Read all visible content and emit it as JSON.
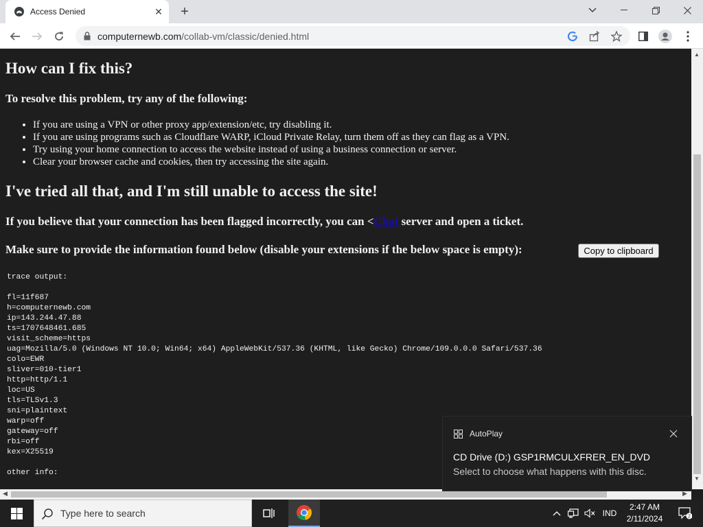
{
  "browser": {
    "tab_title": "Access Denied",
    "url_host": "computernewb.com",
    "url_path": "/collab-vm/classic/denied.html"
  },
  "page": {
    "heading_fix": "How can I fix this?",
    "subheading_resolve": "To resolve this problem, try any of the following:",
    "fix_items": [
      "If you are using a VPN or other proxy app/extension/etc, try disabling it.",
      "If you are using programs such as Cloudflare WARP, iCloud Private Relay, turn them off as they can flag as a VPN.",
      "Try using your home connection to access the website instead of using a business connection or server.",
      "Clear your browser cache and cookies, then try accessing the site again."
    ],
    "heading_tried": "I've tried all that, and I'm still unable to access the site!",
    "flagged_prefix": "If you believe that your connection has been flagged incorrectly, you can <",
    "flagged_link": "Chat",
    "flagged_suffix": " server and open a ticket.",
    "provide_info": "Make sure to provide the information found below (disable your extensions if the below space is empty):",
    "copy_button": "Copy to clipboard",
    "trace_lines": [
      "trace output:",
      "",
      "fl=11f687",
      "h=computernewb.com",
      "ip=143.244.47.88",
      "ts=1707648461.685",
      "visit_scheme=https",
      "uag=Mozilla/5.0 (Windows NT 10.0; Win64; x64) AppleWebKit/537.36 (KHTML, like Gecko) Chrome/109.0.0.0 Safari/537.36",
      "colo=EWR",
      "sliver=010-tier1",
      "http=http/1.1",
      "loc=US",
      "tls=TLSv1.3",
      "sni=plaintext",
      "warp=off",
      "gateway=off",
      "rbi=off",
      "kex=X25519",
      "",
      "other info:"
    ]
  },
  "toast": {
    "app_name": "AutoPlay",
    "title": "CD Drive (D:) GSP1RMCULXFRER_EN_DVD",
    "body": "Select to choose what happens with this disc."
  },
  "taskbar": {
    "search_placeholder": "Type here to search",
    "language": "IND",
    "time": "2:47 AM",
    "date": "2/11/2024"
  }
}
